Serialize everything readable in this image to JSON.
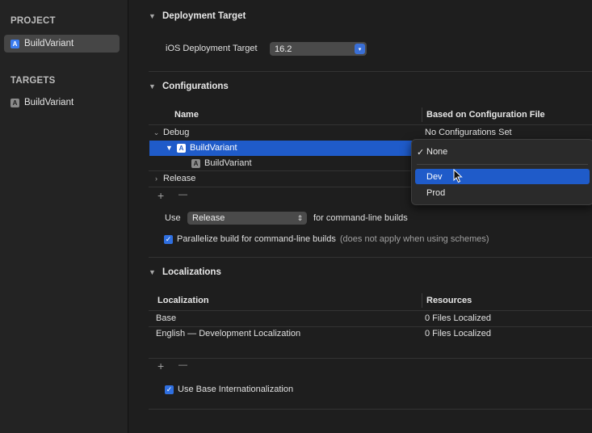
{
  "sidebar": {
    "project_heading": "PROJECT",
    "project_item": "BuildVariant",
    "targets_heading": "TARGETS",
    "target_item": "BuildVariant"
  },
  "deployment": {
    "title": "Deployment Target",
    "label": "iOS Deployment Target",
    "value": "16.2"
  },
  "configurations": {
    "title": "Configurations",
    "col_name": "Name",
    "col_based": "Based on Configuration File",
    "debug_label": "Debug",
    "debug_value": "No Configurations Set",
    "project_row": "BuildVariant",
    "target_row": "BuildVariant",
    "release_label": "Release",
    "add": "+",
    "remove": "—",
    "use_label": "Use",
    "use_value": "Release",
    "use_suffix": "for command-line builds",
    "parallelize_label": "Parallelize build for command-line builds",
    "parallelize_note": "(does not apply when using schemes)"
  },
  "localizations": {
    "title": "Localizations",
    "col_localization": "Localization",
    "col_resources": "Resources",
    "rows": [
      {
        "name": "Base",
        "resources": "0 Files Localized"
      },
      {
        "name": "English — Development Localization",
        "resources": "0 Files Localized"
      }
    ],
    "add": "+",
    "remove": "—",
    "use_base_label": "Use Base Internationalization"
  },
  "menu": {
    "checkmark": "✓",
    "items": [
      "None",
      "Dev",
      "Prod"
    ],
    "selected": "None",
    "highlighted": "Dev"
  },
  "colors": {
    "accent": "#1f5bc9",
    "background": "#1e1e1e",
    "sidebar": "#232323"
  }
}
